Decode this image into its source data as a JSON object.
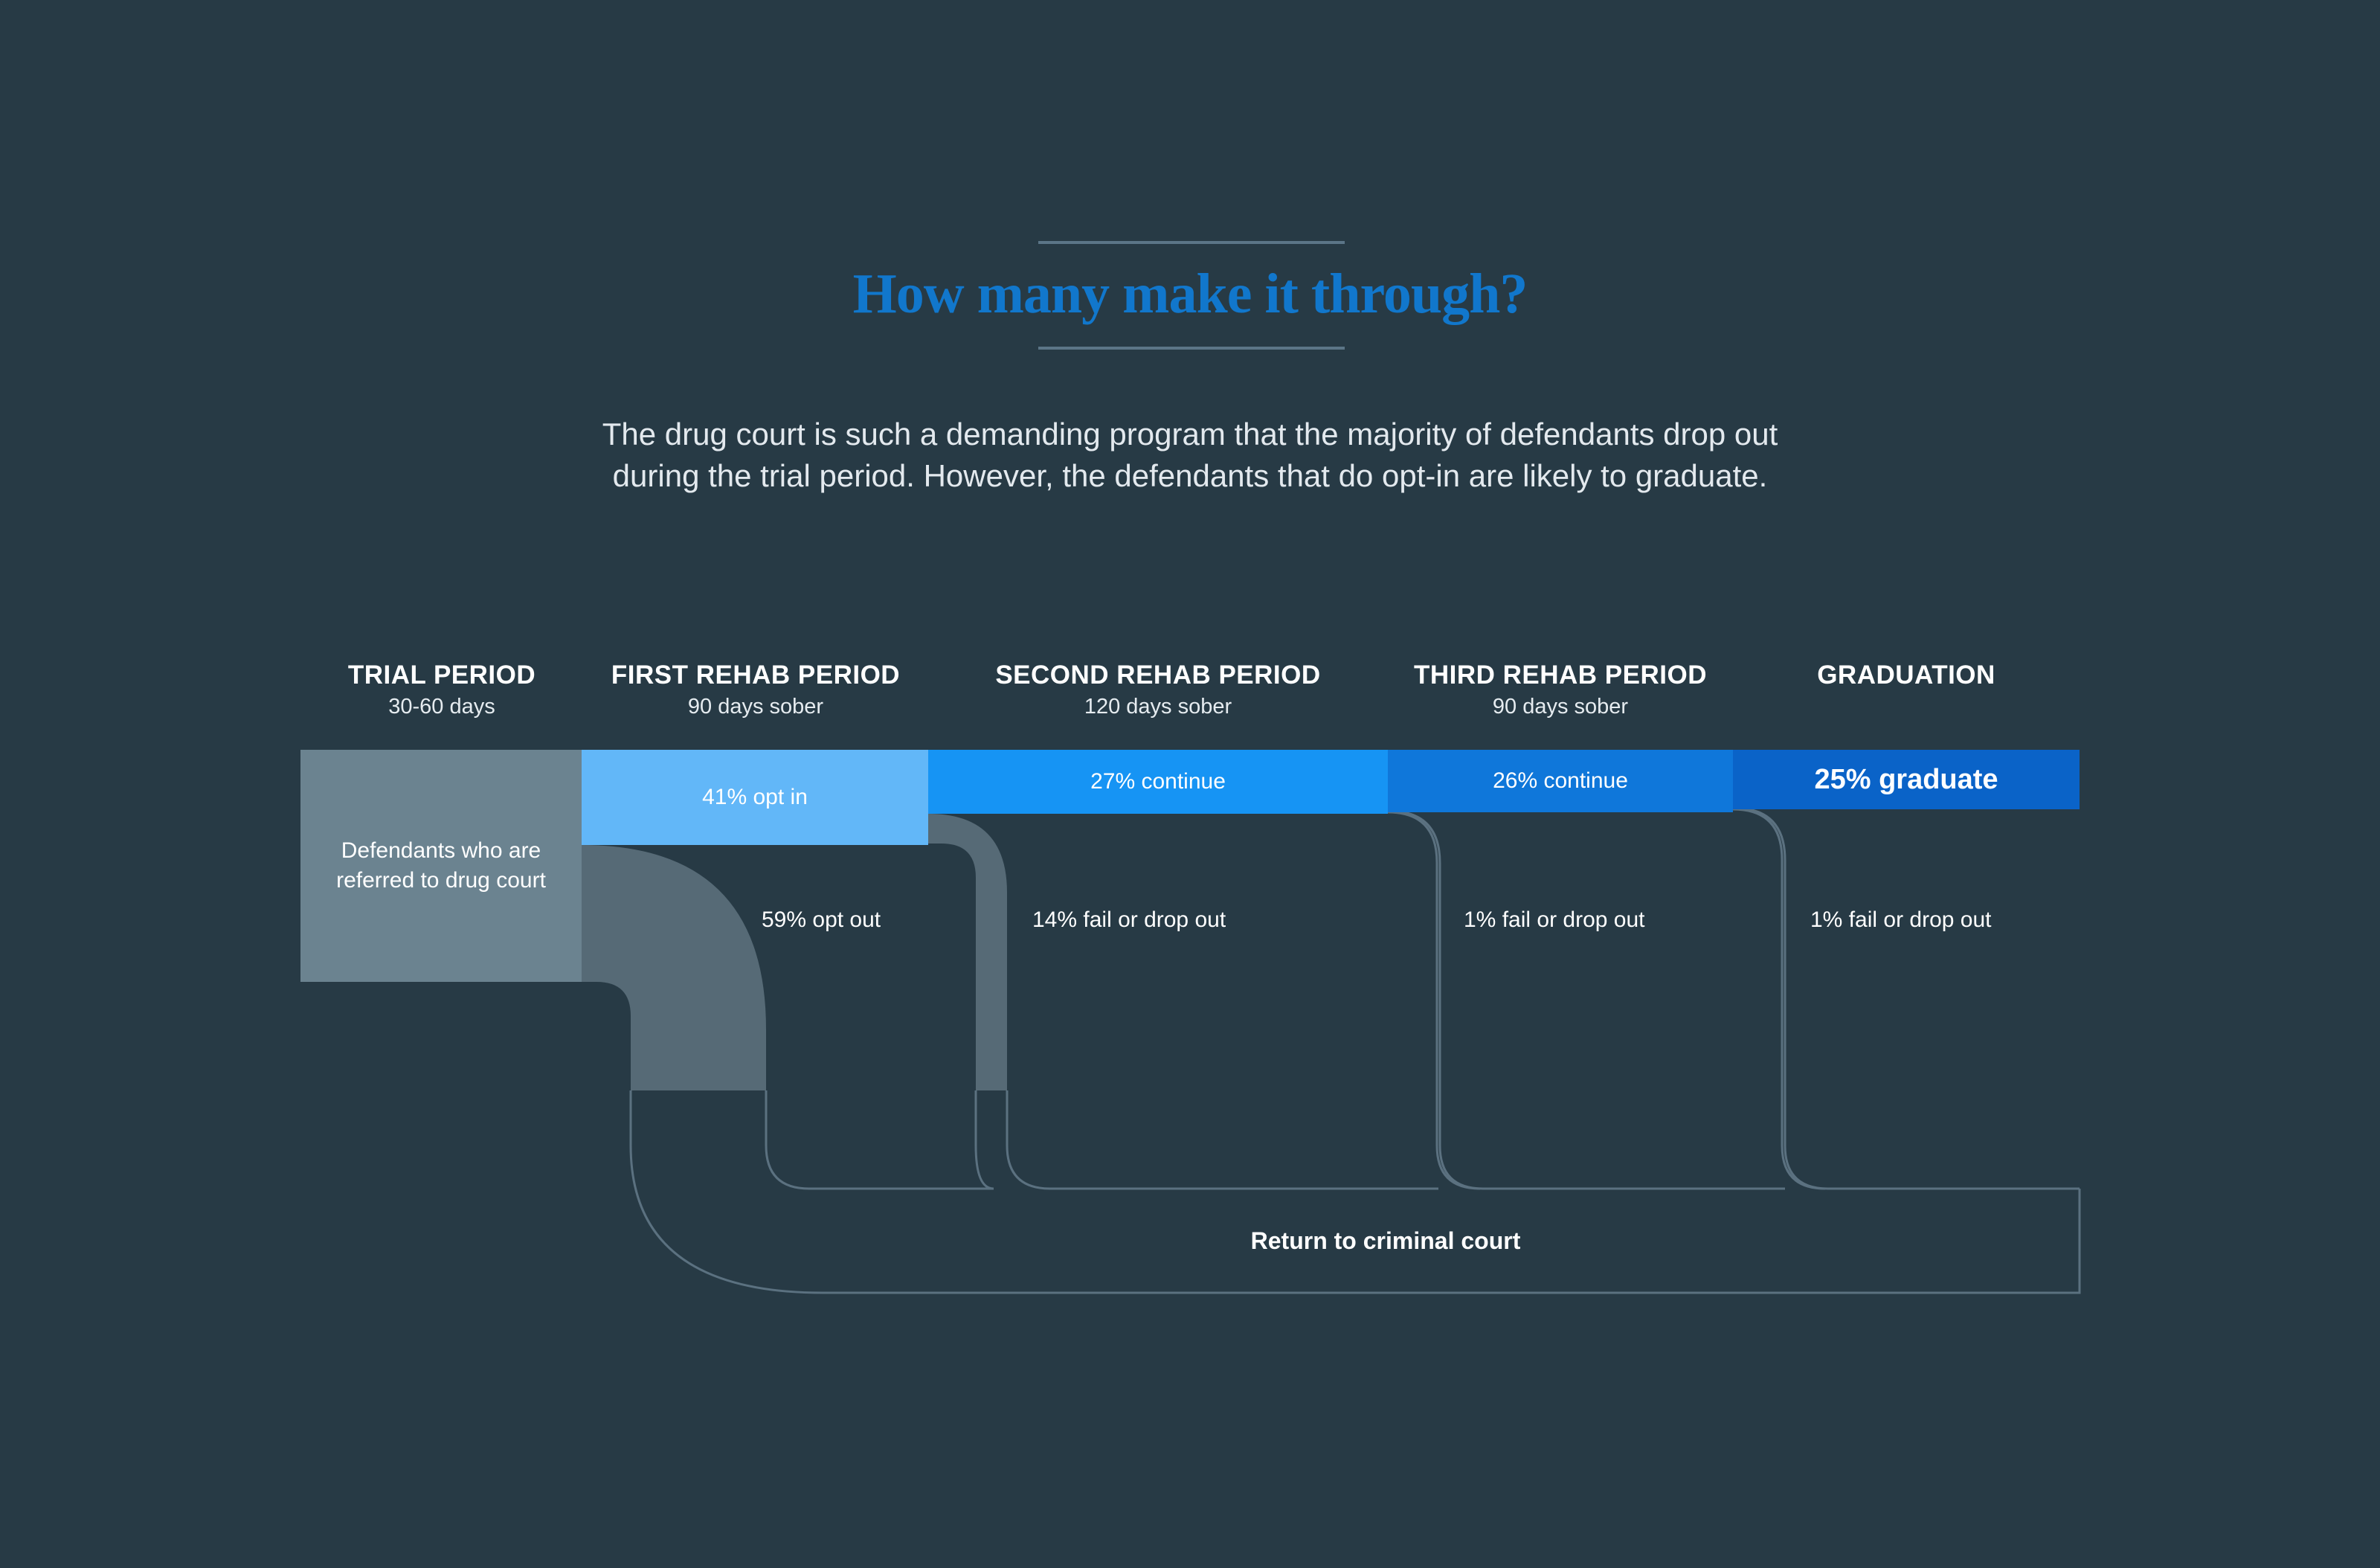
{
  "title": "How many make it through?",
  "subtitle": {
    "line1": "The drug court is such a demanding program that the majority of defendants drop out",
    "line2": "during the trial period. However, the defendants that do opt-in are likely to graduate."
  },
  "stages": [
    {
      "name": "TRIAL PERIOD",
      "duration": "30-60 days"
    },
    {
      "name": "FIRST REHAB PERIOD",
      "duration": "90 days sober"
    },
    {
      "name": "SECOND REHAB PERIOD",
      "duration": "120 days sober"
    },
    {
      "name": "THIRD REHAB PERIOD",
      "duration": "90 days sober"
    },
    {
      "name": "GRADUATION",
      "duration": ""
    }
  ],
  "start_label": "Defendants who are referred to drug court",
  "flows": {
    "opt_in": {
      "label": "41% opt in",
      "percent": 41
    },
    "continue_second": {
      "label": "27% continue",
      "percent": 27
    },
    "continue_third": {
      "label": "26% continue",
      "percent": 26
    },
    "graduate": {
      "label": "25% graduate",
      "percent": 25
    }
  },
  "dropouts": {
    "opt_out": {
      "label": "59% opt out",
      "percent": 59
    },
    "first_fail": {
      "label": "14% fail or drop out",
      "percent": 14
    },
    "second_fail": {
      "label": "1% fail or drop out",
      "percent": 1
    },
    "third_fail": {
      "label": "1% fail or drop out",
      "percent": 1
    }
  },
  "return_label": "Return to criminal court",
  "colors": {
    "background": "#273a45",
    "title": "#1177cc",
    "start": "#6b8390",
    "opt_in": "#62b7f8",
    "continue_second": "#1694f4",
    "continue_third": "#0f77da",
    "graduate": "#0a63c8",
    "dropout": "#566a76",
    "outline": "#5b7180"
  }
}
